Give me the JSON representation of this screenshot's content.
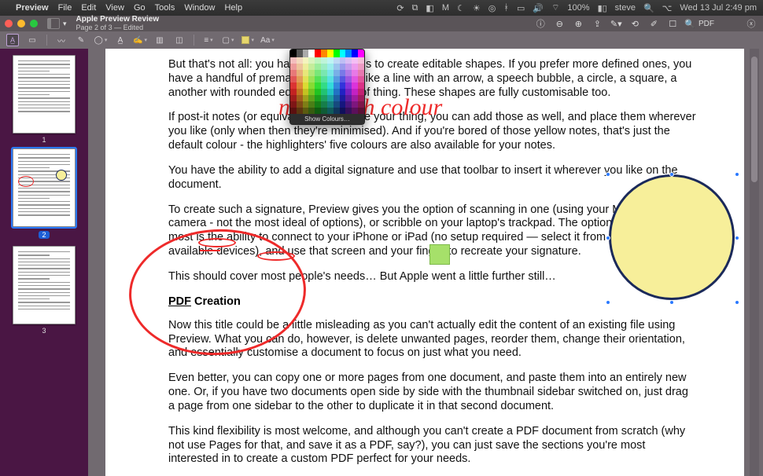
{
  "menubar": {
    "app": "Preview",
    "items": [
      "File",
      "Edit",
      "View",
      "Go",
      "Tools",
      "Window",
      "Help"
    ],
    "status": {
      "wifi_icon": "wifi",
      "battery": "100%",
      "user": "steve",
      "clock": "Wed 13 Jul  2:49 pm"
    }
  },
  "window": {
    "title": "Apple Preview Review",
    "subtitle": "Page 2 of 3 — Edited",
    "search_placeholder": "PDF"
  },
  "markup": {
    "tools": [
      "text-select",
      "rect-select",
      "lasso",
      "redact",
      "draw",
      "shapes",
      "text",
      "sign",
      "note",
      "crop"
    ],
    "style_tools": [
      "line-weight",
      "stroke-color",
      "fill-color",
      "text-style"
    ]
  },
  "sidebar": {
    "pages": [
      {
        "num": "1",
        "selected": false
      },
      {
        "num": "2",
        "selected": true
      },
      {
        "num": "3",
        "selected": false
      }
    ]
  },
  "picker": {
    "footer": "Show Colours…"
  },
  "document": {
    "script_note": "notes with colour",
    "paragraphs": {
      "p1": "But that's not all: you have multiple tools to create editable shapes. If you prefer more defined ones, you have a handful of premade templates, like a line with an arrow, a speech bubble, a circle, a square, a another with rounded edges, that sort of thing. These shapes are fully customisable too.",
      "p2": "If post-it notes (or equivalents) are more your thing, you can add those as well, and place them wherever you like (only when then they're minimised). And if you're bored of those yellow notes, that's just the default colour - the highlighters' five colours are also available for your notes.",
      "p3": "You have the ability to add a digital signature and use that toolbar to insert it wherever you like on the document.",
      "p4": "To create such a signature, Preview gives you the option of scanning in one (using your Mac's built-in camera - not the most ideal of options), or scribble on your laptop's trackpad. The option we liked the most is the ability to connect to your iPhone or iPad (no setup required — select it from the list of available devices), and use that screen and your finger to recreate your signature.",
      "p5": "This should cover most people's needs… But Apple went a little further still…",
      "h1a": "PDF",
      "h1b": " Creation",
      "p6": "Now this title could be a little misleading as you can't actually edit the content of an existing file using Preview. What you can do, however, is delete unwanted pages, reorder them, change their orientation, and essentially customise a document to focus on just what you need.",
      "p7": "Even better, you can copy one or more pages from one document, and paste them into an entirely new one. Or, if you have two documents open side by side with the thumbnail sidebar switched on, just drag a page from one sidebar to the other to duplicate it in that second document.",
      "p8": "This kind flexibility is most welcome, and although you can't create a PDF document from scratch (why not use Pages for that, and save it as a PDF, say?), you can just save the sections you're most interested in to create a custom PDF perfect for your needs."
    }
  }
}
